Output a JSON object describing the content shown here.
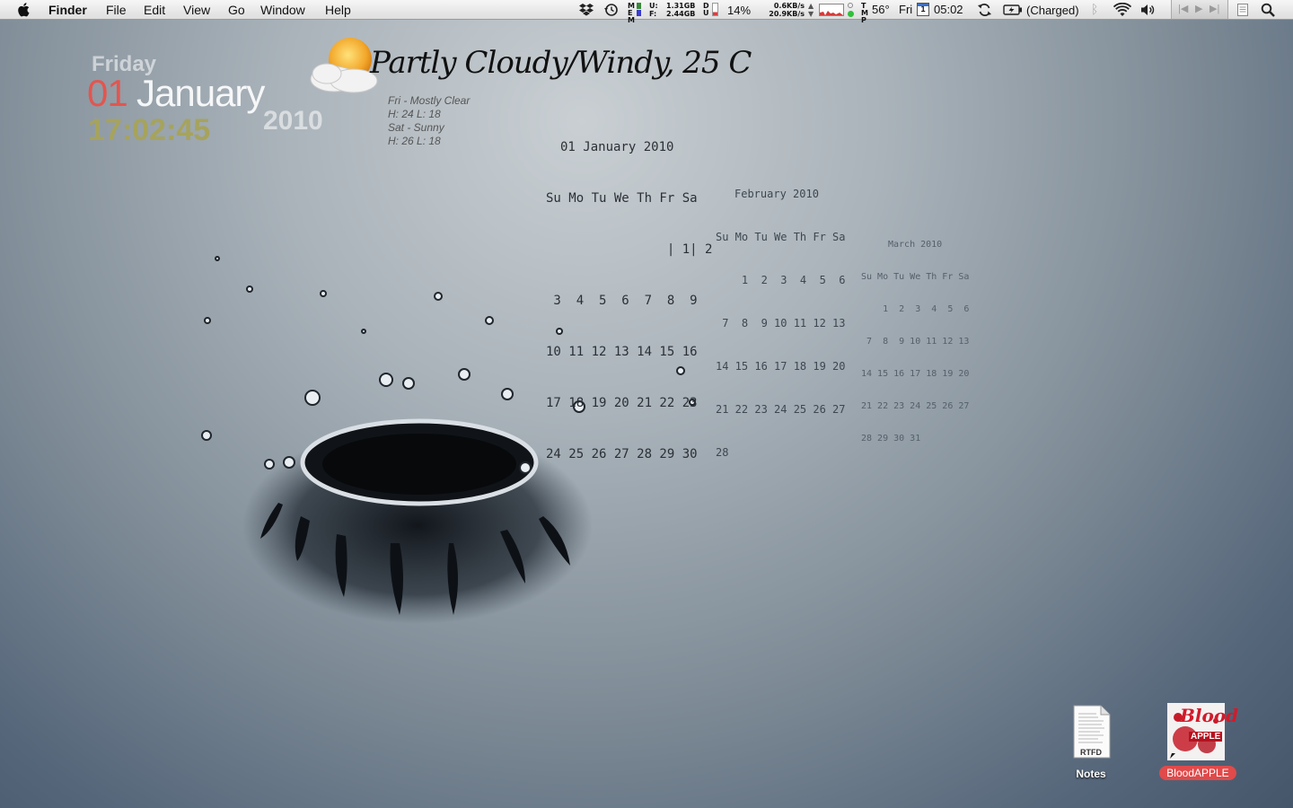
{
  "menubar": {
    "app_name": "Finder",
    "menus": [
      "File",
      "Edit",
      "View",
      "Go",
      "Window",
      "Help"
    ],
    "memory": {
      "used_label": "U:",
      "used": "1.31GB",
      "free_label": "F:",
      "free": "2.44GB",
      "mem_letters": "MEM"
    },
    "disk_letters": "DU",
    "cpu": "14%",
    "network": {
      "up": "0.6KB/s",
      "down": "20.9KB/s"
    },
    "temp_letters": "TMP",
    "temperature": "56°",
    "day": "Fri",
    "calendar_icon_day": "1",
    "time": "05:02",
    "battery_status": "(Charged)",
    "icons": [
      "apple-icon",
      "dropbox-icon",
      "time-machine-icon",
      "sync-icon",
      "battery-icon",
      "bluetooth-icon",
      "wifi-icon",
      "volume-icon",
      "previous-track-icon",
      "play-icon",
      "next-track-icon",
      "notes-menu-icon",
      "spotlight-icon"
    ]
  },
  "date_widget": {
    "day_name": "Friday",
    "day_number": "01",
    "month": "January",
    "year": "2010",
    "clock": "17:02:45"
  },
  "weather": {
    "title": "Partly Cloudy/Windy, 25 C",
    "forecast": [
      {
        "line1": "Fri - Mostly Clear",
        "line2": "H: 24 L: 18"
      },
      {
        "line1": "Sat - Sunny",
        "line2": "H: 26 L: 18"
      }
    ]
  },
  "calendars": {
    "january": {
      "title": "01 January 2010",
      "header": "Su Mo Tu We Th Fr Sa",
      "rows": [
        "                | 1| 2",
        " 3  4  5  6  7  8  9",
        "10 11 12 13 14 15 16",
        "17 18 19 20 21 22 23",
        "24 25 26 27 28 29 30"
      ]
    },
    "february": {
      "title": "February 2010",
      "header": "Su Mo Tu We Th Fr Sa",
      "rows": [
        "    1  2  3  4  5  6",
        " 7  8  9 10 11 12 13",
        "14 15 16 17 18 19 20",
        "21 22 23 24 25 26 27",
        "28"
      ]
    },
    "march": {
      "title": "March 2010",
      "header": "Su Mo Tu We Th Fr Sa",
      "rows": [
        "    1  2  3  4  5  6",
        " 7  8  9 10 11 12 13",
        "14 15 16 17 18 19 20",
        "21 22 23 24 25 26 27",
        "28 29 30 31"
      ]
    }
  },
  "desktop_icons": [
    {
      "label": "Notes",
      "badge": "RTFD"
    },
    {
      "label": "BloodAPPLE",
      "art_text_1": "Blood",
      "art_text_2": "APPLE"
    }
  ],
  "colors": {
    "day_number": "#e2564f",
    "clock": "#a6a35c",
    "label_highlight": "#e04a4a"
  }
}
